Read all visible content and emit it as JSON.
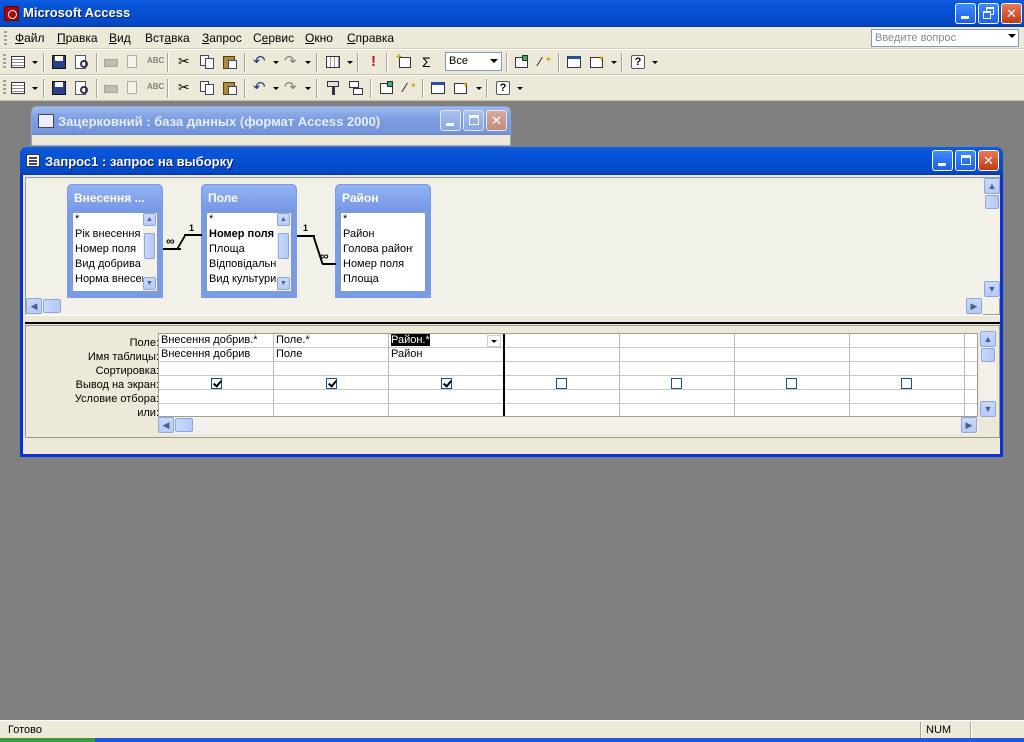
{
  "app": {
    "title": "Microsoft Access"
  },
  "menu": {
    "items": [
      {
        "pre": "",
        "u": "Ф",
        "post": "айл"
      },
      {
        "pre": "",
        "u": "П",
        "post": "равка"
      },
      {
        "pre": "",
        "u": "В",
        "post": "ид"
      },
      {
        "pre": "Вст",
        "u": "а",
        "post": "вка"
      },
      {
        "pre": "",
        "u": "З",
        "post": "апрос"
      },
      {
        "pre": "С",
        "u": "е",
        "post": "рвис"
      },
      {
        "pre": "",
        "u": "О",
        "post": "кно"
      },
      {
        "pre": "",
        "u": "С",
        "post": "правка"
      }
    ],
    "ask_placeholder": "Введите вопрос"
  },
  "toolbar": {
    "top_values_combo": "Все",
    "sigma": "Σ",
    "run": "!"
  },
  "db_window": {
    "title": "Зацерковний : база данных (формат Access 2000)"
  },
  "query_window": {
    "title": "Запрос1 : запрос на выборку"
  },
  "tables": [
    {
      "name": "Внесення ...",
      "fields": [
        "*",
        "Рік внесення",
        "Номер поля",
        "Вид добрива",
        "Норма внесен"
      ],
      "key_index": -1
    },
    {
      "name": "Поле",
      "fields": [
        "*",
        "Номер поля",
        "Площа",
        "Відповідальн",
        "Вид культури"
      ],
      "key_index": 1
    },
    {
      "name": "Район",
      "fields": [
        "*",
        "Район",
        "Голова району",
        "Номер поля",
        "Площа"
      ],
      "key_index": -1
    }
  ],
  "relations": [
    {
      "one": "1",
      "many": "∞"
    },
    {
      "one": "1",
      "many": "∞"
    }
  ],
  "grid": {
    "row_labels": [
      "Поле:",
      "Имя таблицы:",
      "Сортировка:",
      "Вывод на экран:",
      "Условие отбора:",
      "или:"
    ],
    "columns": [
      {
        "field": "Внесення добрив.*",
        "table": "Внесення добрив",
        "show": true
      },
      {
        "field": "Поле.*",
        "table": "Поле",
        "show": true
      },
      {
        "field": "Район.*",
        "table": "Район",
        "show": true,
        "selected": true
      },
      {
        "field": "",
        "table": "",
        "show": false
      },
      {
        "field": "",
        "table": "",
        "show": false
      },
      {
        "field": "",
        "table": "",
        "show": false
      },
      {
        "field": "",
        "table": "",
        "show": false
      }
    ]
  },
  "status": {
    "text": "Готово",
    "num": "NUM"
  },
  "colors": {
    "title_blue": "#0450d2",
    "window_bg": "#ece9d8",
    "mdi_bg": "#808080",
    "table_header": "#7a9ae4"
  }
}
